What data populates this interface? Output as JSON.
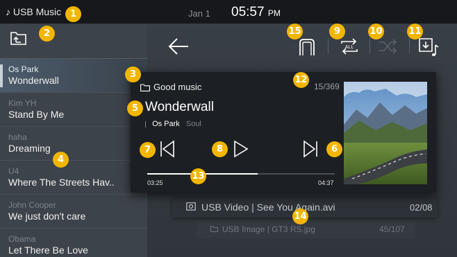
{
  "status_bar": {
    "source": "USB Music",
    "source_icon": "music-note-icon",
    "date": "Jan 1",
    "time": "05:57",
    "ampm": "PM"
  },
  "sidebar": {
    "folder_up_icon": "folder-up-icon",
    "items": [
      {
        "artist": "Os Park",
        "title": "Wonderwall",
        "active": true
      },
      {
        "artist": "Kim YH",
        "title": "Stand By Me",
        "active": false
      },
      {
        "artist": "haha",
        "title": "Dreaming",
        "active": false
      },
      {
        "artist": "U4",
        "title": "Where The Streets Hav..",
        "active": false
      },
      {
        "artist": "John Cooper",
        "title": "We just don't care",
        "active": false
      },
      {
        "artist": "Obama",
        "title": "Let There Be Love",
        "active": false
      }
    ]
  },
  "toolbar": {
    "back_icon": "back-arrow-icon",
    "icons": [
      "bluetooth-audio-icon",
      "repeat-all-icon",
      "shuffle-icon",
      "download-music-icon"
    ],
    "repeat_label": "ALL"
  },
  "now_playing": {
    "folder": "Good music",
    "track_position": "15/369",
    "title": "Wonderwall",
    "artist": "Os Park",
    "genre": "Soul",
    "time_current": "03:25",
    "time_total": "04:37",
    "progress": 0.59
  },
  "other_media": [
    {
      "type": "USB Video",
      "file": "See You Again.avi",
      "count": "02/08",
      "separator": "|"
    },
    {
      "type": "USB Image",
      "file": "GT3 RS.jpg",
      "count": "45/107",
      "separator": "|"
    }
  ],
  "badges": [
    "1",
    "2",
    "3",
    "4",
    "5",
    "6",
    "7",
    "8",
    "9",
    "10",
    "11",
    "12",
    "13",
    "14",
    "15"
  ],
  "colors": {
    "badge": "#f2b600",
    "active_item": "#4c5b6b",
    "card": "#1c1f23"
  }
}
